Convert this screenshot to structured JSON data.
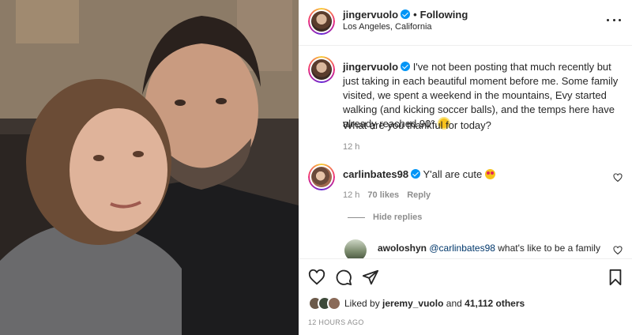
{
  "header": {
    "username": "jingervuolo",
    "follow_status": "Following",
    "location": "Los Angeles, California"
  },
  "caption": {
    "username": "jingervuolo",
    "text": "I've not been posting that much recently but just taking in each beautiful moment before me. Some family visited, we spent a weekend in the mountains, Evy started walking (and kicking soccer balls), and the temps here have already reached 90°.",
    "question": "What are you thankful for today?",
    "time": "12 h"
  },
  "comments": [
    {
      "username": "carlinbates98",
      "text": "Y'all are cute",
      "time": "12 h",
      "likes": "70 likes",
      "reply_label": "Reply"
    }
  ],
  "replies": {
    "toggle_label": "Hide replies",
    "items": [
      {
        "username": "awoloshyn",
        "mention": "@carlinbates98",
        "text": "what's like to be a family"
      }
    ]
  },
  "likes": {
    "prefix": "Liked by",
    "user": "jeremy_vuolo",
    "joiner": "and",
    "others": "41,112 others"
  },
  "post_time": "12 HOURS AGO",
  "icons": [
    "more-icon",
    "verified-icon",
    "heart-icon",
    "comment-icon",
    "share-icon",
    "bookmark-icon"
  ],
  "colors": {
    "verified": "#0095f6",
    "text": "#262626",
    "muted": "#8e8e8e",
    "mention": "#00376b"
  }
}
